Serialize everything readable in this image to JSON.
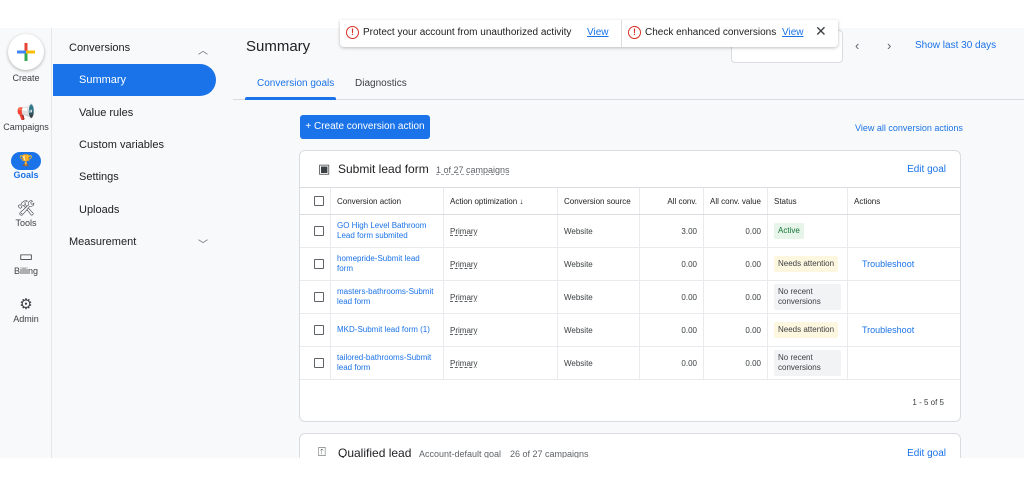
{
  "rail": {
    "create": "Create",
    "campaigns": "Campaigns",
    "goals": "Goals",
    "tools": "Tools",
    "billing": "Billing",
    "admin": "Admin"
  },
  "nav": {
    "conversions": "Conversions",
    "summary": "Summary",
    "value_rules": "Value rules",
    "custom_variables": "Custom variables",
    "settings": "Settings",
    "uploads": "Uploads",
    "measurement": "Measurement"
  },
  "header": {
    "title": "Summary",
    "show_last": "Show last 30 days"
  },
  "banner": {
    "msg1": "Protect your account from unauthorized activity",
    "msg2": "Check enhanced conversions",
    "view": "View",
    "close": "✕"
  },
  "tabs": [
    "Conversion goals",
    "Diagnostics"
  ],
  "toolbar": {
    "create_action": "+ Create conversion action",
    "view_all": "View all conversion actions"
  },
  "goal1": {
    "title": "Submit lead form",
    "campaigns": "1 of 27 campaigns",
    "edit": "Edit goal",
    "columns": [
      "Conversion action",
      "Action optimization",
      "Conversion source",
      "All conv.",
      "All conv. value",
      "Status",
      "Actions"
    ],
    "rows": [
      {
        "name": "GO High Level Bathroom Lead form submited",
        "opt": "Primary",
        "source": "Website",
        "conv": "3.00",
        "value": "0.00",
        "status": "Active",
        "status_type": "active",
        "action": ""
      },
      {
        "name": "homepride-Submit lead form",
        "opt": "Primary",
        "source": "Website",
        "conv": "0.00",
        "value": "0.00",
        "status": "Needs attention",
        "status_type": "attn",
        "action": "Troubleshoot"
      },
      {
        "name": "masters-bathrooms-Submit lead form",
        "opt": "Primary",
        "source": "Website",
        "conv": "0.00",
        "value": "0.00",
        "status": "No recent conversions",
        "status_type": "none",
        "action": ""
      },
      {
        "name": "MKD-Submit lead form (1)",
        "opt": "Primary",
        "source": "Website",
        "conv": "0.00",
        "value": "0.00",
        "status": "Needs attention",
        "status_type": "attn",
        "action": "Troubleshoot"
      },
      {
        "name": "tailored-bathrooms-Submit lead form",
        "opt": "Primary",
        "source": "Website",
        "conv": "0.00",
        "value": "0.00",
        "status": "No recent conversions",
        "status_type": "none",
        "action": ""
      }
    ],
    "pager": "1 - 5 of 5"
  },
  "goal2": {
    "title": "Qualified lead",
    "default": "Account-default goal",
    "campaigns": "26 of 27 campaigns",
    "edit": "Edit goal"
  }
}
